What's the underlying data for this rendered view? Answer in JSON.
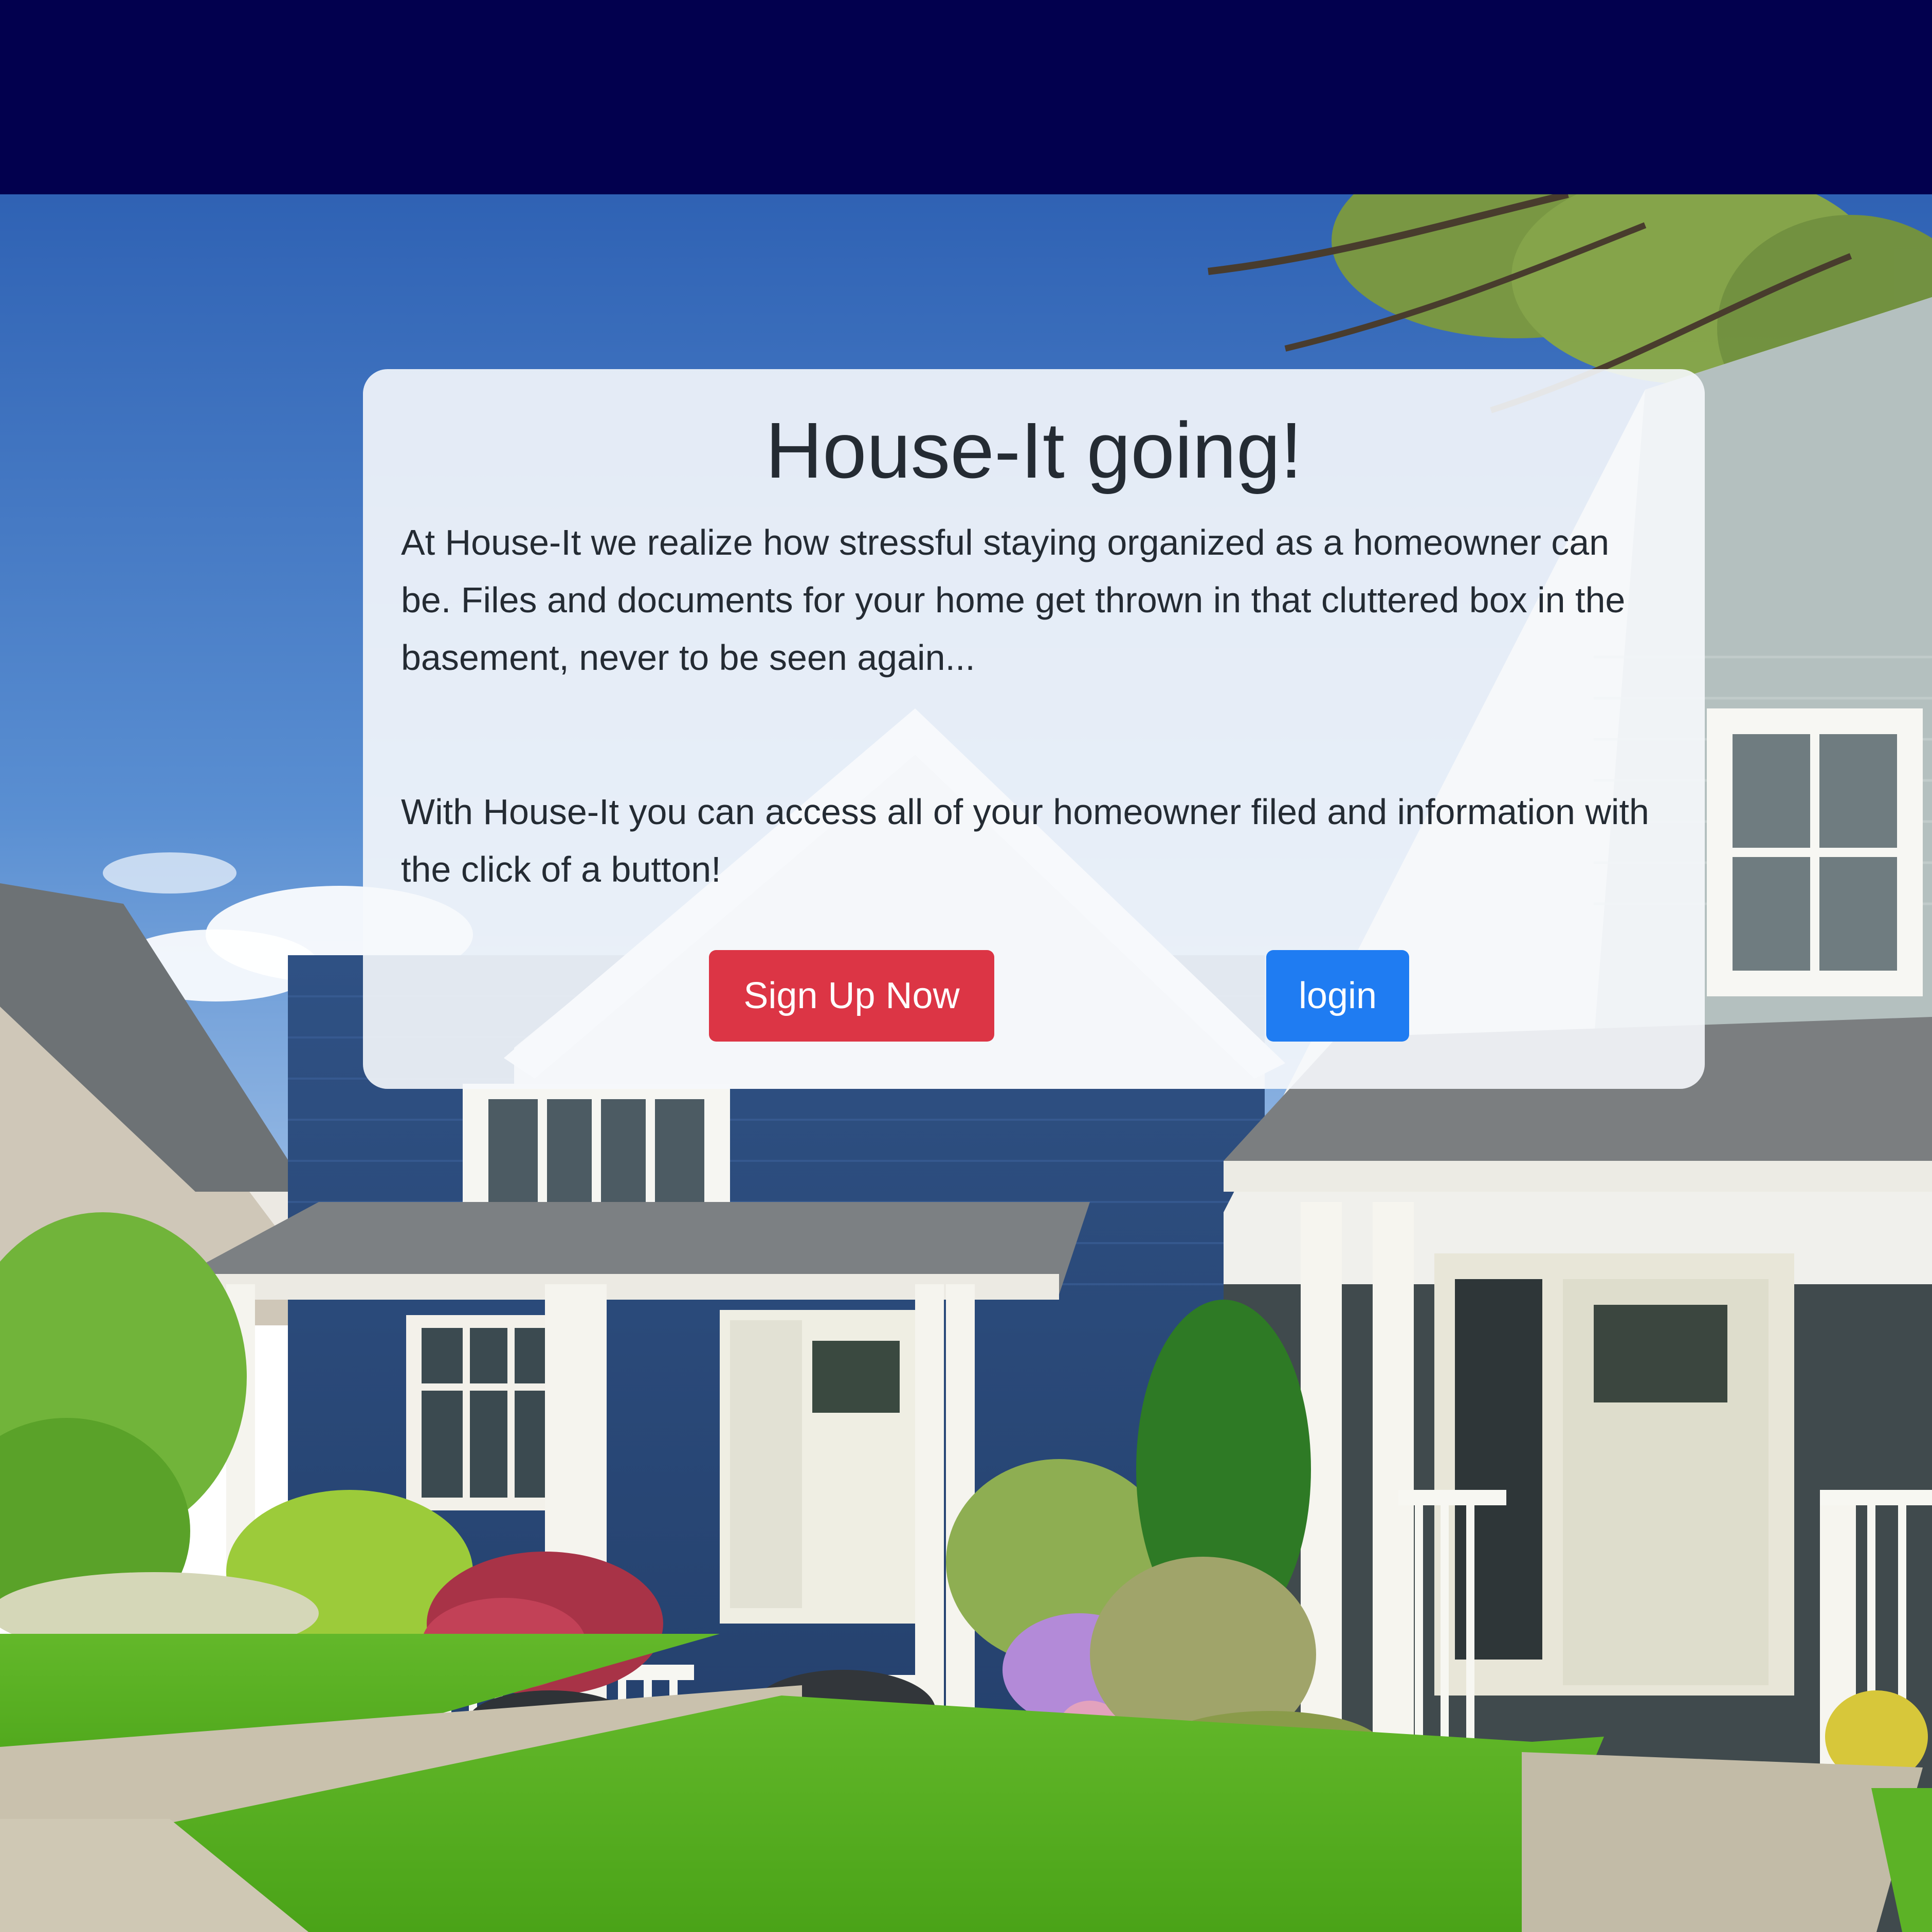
{
  "navbar": {},
  "hero": {
    "heading": "House-It going!",
    "paragraph_1": "At House-It we realize how stressful staying organized as a homeowner can be. Files and documents for your home get thrown in that cluttered box in the basement, never to be seen again...",
    "paragraph_2": "With House-It you can access all of your homeowner filed and information with the click of a button!",
    "signup_label": "Sign Up Now",
    "login_label": "login"
  },
  "colors": {
    "navbar_bg": "#02004e",
    "signup_button": "#dc3545",
    "login_button": "#1f7cf2",
    "text": "#242b33"
  }
}
